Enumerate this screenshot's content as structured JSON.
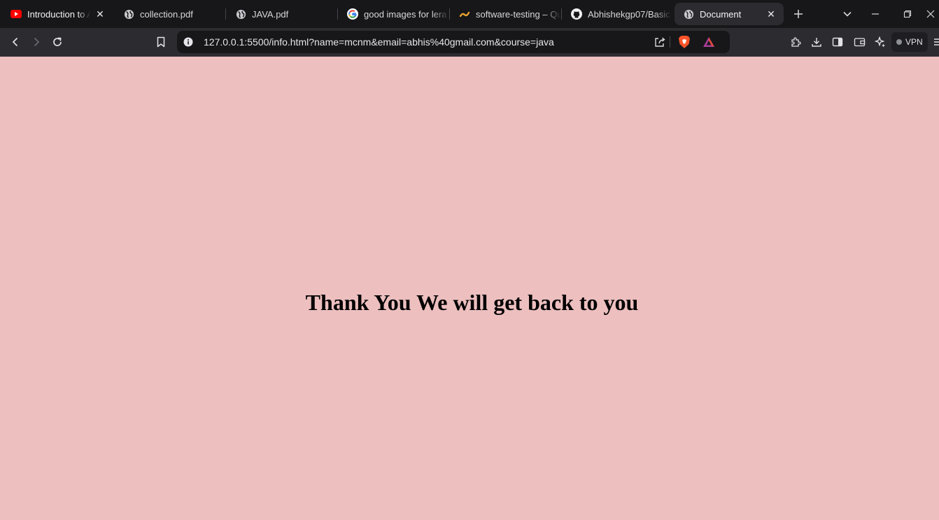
{
  "browser": {
    "tabs": [
      {
        "title": "Introduction to A",
        "icon": "youtube-icon",
        "active": false
      },
      {
        "title": "collection.pdf",
        "icon": "globe-icon",
        "active": false
      },
      {
        "title": "JAVA.pdf",
        "icon": "globe-icon",
        "active": false
      },
      {
        "title": "good images for lera",
        "icon": "google-icon",
        "active": false
      },
      {
        "title": "software-testing – Qu",
        "icon": "quizlet-link-icon",
        "active": false
      },
      {
        "title": "Abhishekgp07/Basic",
        "icon": "github-icon",
        "active": false
      },
      {
        "title": "Document",
        "icon": "globe-icon",
        "active": true
      }
    ],
    "address_bar": {
      "url": "127.0.0.1:5500/info.html?name=mcnm&email=abhis%40gmail.com&course=java"
    },
    "vpn_label": "VPN",
    "colors": {
      "tabstrip_bg": "#17171a",
      "toolbar_bg": "#2b2b30",
      "brave_orange": "#fb542b",
      "youtube_red": "#ff0000"
    }
  },
  "page": {
    "background_color": "#edbfbf",
    "heading": "Thank You We will get back to you"
  }
}
